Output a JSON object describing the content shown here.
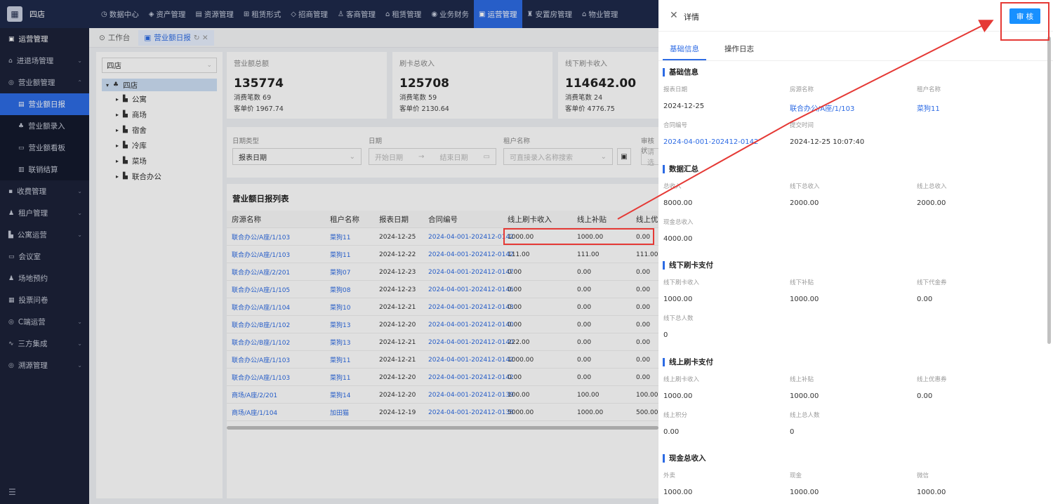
{
  "topbar": {
    "brand": "四店",
    "nav": [
      {
        "icon": "dashboard-icon",
        "glyph": "◷",
        "label": "数据中心",
        "active": false
      },
      {
        "icon": "cube-icon",
        "glyph": "◈",
        "label": "资产管理",
        "active": false
      },
      {
        "icon": "building-icon",
        "glyph": "▤",
        "label": "资源管理",
        "active": false
      },
      {
        "icon": "grid-icon",
        "glyph": "⊞",
        "label": "租赁形式",
        "active": false
      },
      {
        "icon": "tag-icon",
        "glyph": "◇",
        "label": "招商管理",
        "active": false
      },
      {
        "icon": "users-icon",
        "glyph": "♙",
        "label": "客商管理",
        "active": false
      },
      {
        "icon": "house-icon",
        "glyph": "⌂",
        "label": "租赁管理",
        "active": false
      },
      {
        "icon": "money-icon",
        "glyph": "◉",
        "label": "业务财务",
        "active": false
      },
      {
        "icon": "ops-icon",
        "glyph": "▣",
        "label": "运营管理",
        "active": true
      },
      {
        "icon": "home-icon",
        "glyph": "♜",
        "label": "安置房管理",
        "active": false
      },
      {
        "icon": "property-icon",
        "glyph": "⌂",
        "label": "物业管理",
        "active": false
      }
    ]
  },
  "sidebar": {
    "items": [
      {
        "label": "运营管理",
        "icon": "ops-icon",
        "glyph": "▣",
        "type": "head"
      },
      {
        "label": "进退场管理",
        "icon": "home-icon",
        "glyph": "⌂",
        "type": "item",
        "chev": true
      },
      {
        "label": "营业额管理",
        "icon": "revenue-icon",
        "glyph": "◎",
        "type": "item",
        "chev": true,
        "open": true
      },
      {
        "label": "营业额日报",
        "icon": "report-icon",
        "glyph": "▤",
        "type": "sub",
        "active": true
      },
      {
        "label": "营业额录入",
        "icon": "entry-icon",
        "glyph": "♣",
        "type": "sub"
      },
      {
        "label": "营业额看板",
        "icon": "board-icon",
        "glyph": "▭",
        "type": "sub"
      },
      {
        "label": "联销结算",
        "icon": "settle-icon",
        "glyph": "▥",
        "type": "sub"
      },
      {
        "label": "收费管理",
        "icon": "fee-icon",
        "glyph": "▪",
        "type": "item",
        "chev": true
      },
      {
        "label": "租户管理",
        "icon": "tenant-icon",
        "glyph": "♟",
        "type": "item",
        "chev": true
      },
      {
        "label": "公寓运营",
        "icon": "apartment-icon",
        "glyph": "▙",
        "type": "item",
        "chev": true
      },
      {
        "label": "会议室",
        "icon": "meeting-icon",
        "glyph": "▭",
        "type": "item"
      },
      {
        "label": "场地预约",
        "icon": "venue-icon",
        "glyph": "♟",
        "type": "item"
      },
      {
        "label": "投票问卷",
        "icon": "vote-icon",
        "glyph": "▦",
        "type": "item"
      },
      {
        "label": "C端运营",
        "icon": "client-icon",
        "glyph": "◎",
        "type": "item",
        "chev": true
      },
      {
        "label": "三方集成",
        "icon": "link-icon",
        "glyph": "∿",
        "type": "item",
        "chev": true
      },
      {
        "label": "溯源管理",
        "icon": "trace-icon",
        "glyph": "◎",
        "type": "item",
        "chev": true
      }
    ],
    "collapse_glyph": "☰"
  },
  "tabs": [
    {
      "label": "工作台",
      "glyph": "⊙",
      "active": false
    },
    {
      "label": "营业额日报",
      "glyph": "▣",
      "active": true,
      "extra": "↻ ✕"
    }
  ],
  "tree": {
    "select_value": "四店",
    "root": "四店",
    "nodes": [
      "公寓",
      "商场",
      "宿舍",
      "冷库",
      "菜场",
      "联合办公"
    ]
  },
  "stats": [
    {
      "title": "营业额总额",
      "value": "135774",
      "count": "消费笔数 69",
      "avg": "客单价 1967.74"
    },
    {
      "title": "刷卡总收入",
      "value": "125708",
      "count": "消费笔数 59",
      "avg": "客单价 2130.64"
    },
    {
      "title": "线下刷卡收入",
      "value": "114642.00",
      "count": "消费笔数 24",
      "avg": "客单价 4776.75"
    }
  ],
  "filter": {
    "date_type_label": "日期类型",
    "date_type_value": "报表日期",
    "date_label": "日期",
    "date_start": "开始日期",
    "date_arrow": "→",
    "date_end": "结束日期",
    "tenant_label": "租户名称",
    "tenant_placeholder": "可直接录入名称搜索",
    "audit_label": "审核状",
    "audit_placeholder": "请选"
  },
  "table": {
    "title": "营业额日报列表",
    "columns": [
      "房源名称",
      "租户名称",
      "报表日期",
      "合同编号",
      "线上刷卡收入",
      "线上补贴",
      "线上优"
    ],
    "rows": [
      [
        "联合办公/A座/1/103",
        "菜狗11",
        "2024-12-25",
        "2024-04-001-202412-0142",
        "1000.00",
        "1000.00",
        "0.00"
      ],
      [
        "联合办公/A座/1/103",
        "菜狗11",
        "2024-12-22",
        "2024-04-001-202412-0142",
        "111.00",
        "111.00",
        "111.00"
      ],
      [
        "联合办公/A座/2/201",
        "菜狗07",
        "2024-12-23",
        "2024-04-001-202412-0147",
        "0.00",
        "0.00",
        "0.00"
      ],
      [
        "联合办公/A座/1/105",
        "菜狗08",
        "2024-12-23",
        "2024-04-001-202412-0146",
        "0.00",
        "0.00",
        "0.00"
      ],
      [
        "联合办公/A座/1/104",
        "菜狗10",
        "2024-12-21",
        "2024-04-001-202412-0143",
        "0.00",
        "0.00",
        "0.00"
      ],
      [
        "联合办公/B座/1/102",
        "菜狗13",
        "2024-12-20",
        "2024-04-001-202412-0140",
        "0.00",
        "0.00",
        "0.00"
      ],
      [
        "联合办公/B座/1/102",
        "菜狗13",
        "2024-12-21",
        "2024-04-001-202412-0140",
        "222.00",
        "0.00",
        "0.00"
      ],
      [
        "联合办公/A座/1/103",
        "菜狗11",
        "2024-12-21",
        "2024-04-001-202412-0142",
        "1000.00",
        "0.00",
        "0.00"
      ],
      [
        "联合办公/A座/1/103",
        "菜狗11",
        "2024-12-20",
        "2024-04-001-202412-0142",
        "0.00",
        "0.00",
        "0.00"
      ],
      [
        "商场/A座/2/201",
        "菜狗14",
        "2024-12-20",
        "2024-04-001-202412-0139",
        "100.00",
        "100.00",
        "100.00"
      ],
      [
        "商场/A座/1/104",
        "加田猫",
        "2024-12-19",
        "2024-04-001-202412-0138",
        "5000.00",
        "1000.00",
        "500.00"
      ]
    ]
  },
  "drawer": {
    "close_glyph": "✕",
    "title": "详情",
    "audit_button": "审 核",
    "tabs": [
      "基础信息",
      "操作日志"
    ],
    "sections": [
      {
        "title": "基础信息",
        "fields": [
          {
            "label": "报表日期",
            "value": "2024-12-25",
            "link": false
          },
          {
            "label": "房源名称",
            "value": "联合办公/A座/1/103",
            "link": true
          },
          {
            "label": "租户名称",
            "value": "菜狗11",
            "link": true
          },
          {
            "label": "合同编号",
            "value": "2024-04-001-202412-0142",
            "link": true
          },
          {
            "label": "提交时间",
            "value": "2024-12-25 10:07:40",
            "link": false
          }
        ]
      },
      {
        "title": "数据汇总",
        "fields": [
          {
            "label": "总收入",
            "value": "8000.00"
          },
          {
            "label": "线下总收入",
            "value": "2000.00"
          },
          {
            "label": "线上总收入",
            "value": "2000.00"
          },
          {
            "label": "现金总收入",
            "value": "4000.00"
          }
        ]
      },
      {
        "title": "线下刷卡支付",
        "fields": [
          {
            "label": "线下刷卡收入",
            "value": "1000.00"
          },
          {
            "label": "线下补贴",
            "value": "1000.00"
          },
          {
            "label": "线下代金券",
            "value": "0.00"
          },
          {
            "label": "线下总人数",
            "value": "0"
          }
        ]
      },
      {
        "title": "线上刷卡支付",
        "fields": [
          {
            "label": "线上刷卡收入",
            "value": "1000.00"
          },
          {
            "label": "线上补贴",
            "value": "1000.00"
          },
          {
            "label": "线上优惠券",
            "value": "0.00"
          },
          {
            "label": "线上积分",
            "value": "0.00"
          },
          {
            "label": "线上总人数",
            "value": "0"
          }
        ]
      },
      {
        "title": "现金总收入",
        "fields": [
          {
            "label": "外卖",
            "value": "1000.00"
          },
          {
            "label": "现金",
            "value": "1000.00"
          },
          {
            "label": "微信",
            "value": "1000.00"
          }
        ]
      }
    ]
  },
  "colors": {
    "accent": "#2d6be4",
    "annotation": "#e53935",
    "button": "#1890ff"
  }
}
